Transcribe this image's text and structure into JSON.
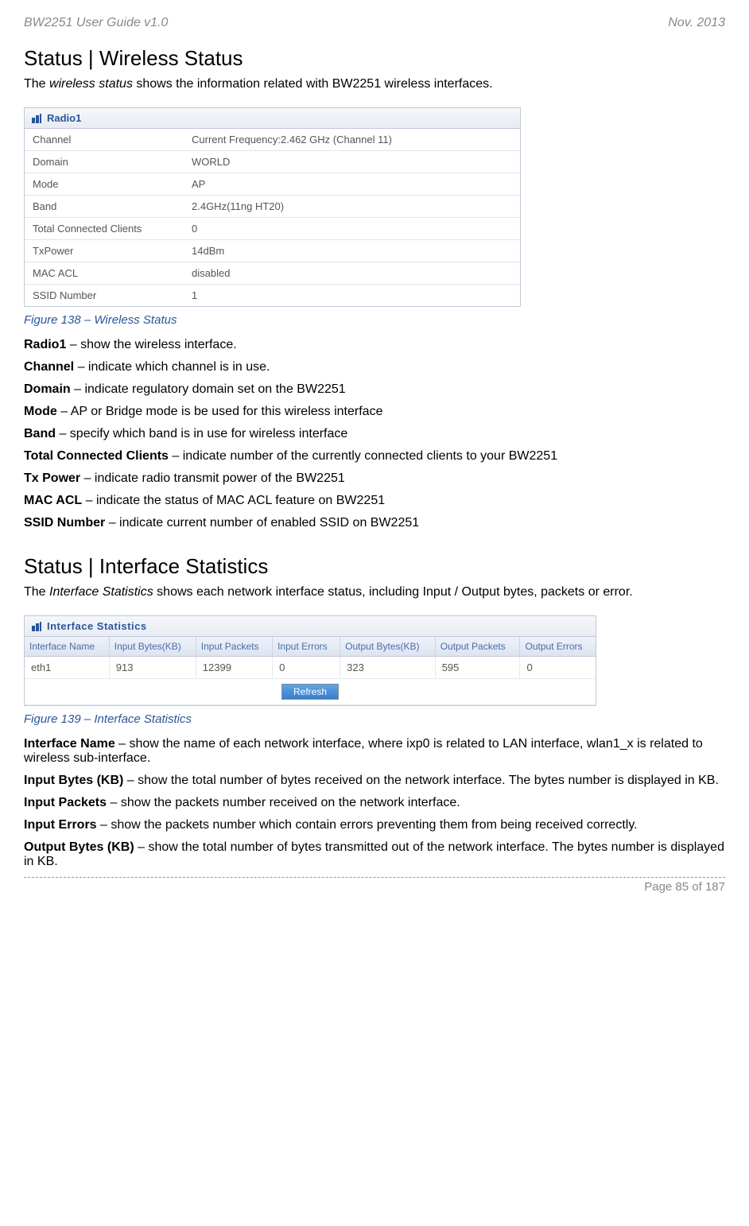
{
  "header": {
    "left": "BW2251 User Guide v1.0",
    "right": "Nov.  2013"
  },
  "section1": {
    "title": "Status | Wireless Status",
    "intro_prefix": "The ",
    "intro_italic": "wireless status",
    "intro_suffix": " shows the information related with BW2251 wireless interfaces."
  },
  "radio_panel": {
    "title": "Radio1",
    "rows": [
      {
        "label": "Channel",
        "value": "Current Frequency:2.462 GHz (Channel 11)"
      },
      {
        "label": "Domain",
        "value": "WORLD"
      },
      {
        "label": "Mode",
        "value": "AP"
      },
      {
        "label": "Band",
        "value": "2.4GHz(11ng HT20)"
      },
      {
        "label": "Total Connected Clients",
        "value": "0"
      },
      {
        "label": "TxPower",
        "value": "14dBm"
      },
      {
        "label": "MAC ACL",
        "value": "disabled"
      },
      {
        "label": "SSID Number",
        "value": "1"
      }
    ]
  },
  "figure138": "Figure 138  – Wireless Status",
  "defs1": [
    {
      "term": "Radio1",
      "desc": " – show the wireless interface."
    },
    {
      "term": "Channel",
      "desc": " – indicate which channel is in use."
    },
    {
      "term": "Domain",
      "desc": " – indicate regulatory domain set on the BW2251"
    },
    {
      "term": "Mode",
      "desc": " – AP or Bridge mode is be used for this wireless interface"
    },
    {
      "term": "Band",
      "desc": " – specify which band is in use for wireless interface"
    },
    {
      "term": "Total Connected Clients",
      "desc": " – indicate number of the currently connected clients to your BW2251"
    },
    {
      "term": "Tx Power",
      "desc": " – indicate radio transmit power of the BW2251"
    },
    {
      "term": "MAC ACL",
      "desc": " – indicate the status of MAC ACL feature on BW2251"
    },
    {
      "term": "SSID Number",
      "desc": " – indicate current number of enabled SSID on BW2251"
    }
  ],
  "section2": {
    "title": "Status | Interface Statistics",
    "intro_prefix": "The ",
    "intro_italic": "Interface Statistics",
    "intro_suffix": " shows each network interface status, including Input / Output bytes, packets or error."
  },
  "stats_panel": {
    "title": "Interface Statistics",
    "headers": [
      "Interface Name",
      "Input Bytes(KB)",
      "Input Packets",
      "Input Errors",
      "Output Bytes(KB)",
      "Output Packets",
      "Output Errors"
    ],
    "row": [
      "eth1",
      "913",
      "12399",
      "0",
      "323",
      "595",
      "0"
    ],
    "refresh": "Refresh"
  },
  "figure139": "Figure 139 – Interface Statistics",
  "defs2": [
    {
      "term": "Interface Name",
      "desc": " – show the name of each network interface, where ixp0 is related to LAN interface, wlan1_x is related to wireless sub-interface."
    },
    {
      "term": "Input Bytes (KB)",
      "desc": " – show the total number of bytes received on the network interface. The bytes number is displayed in KB."
    },
    {
      "term": "Input Packets",
      "desc": " – show the packets number received on the network interface."
    },
    {
      "term": "Input Errors",
      "desc": " – show the packets number which contain errors preventing them from being received correctly."
    },
    {
      "term": "Output Bytes (KB)",
      "desc": " – show the total number of bytes transmitted out of the network interface. The bytes number is displayed in KB."
    }
  ],
  "footer": "Page 85 of 187"
}
